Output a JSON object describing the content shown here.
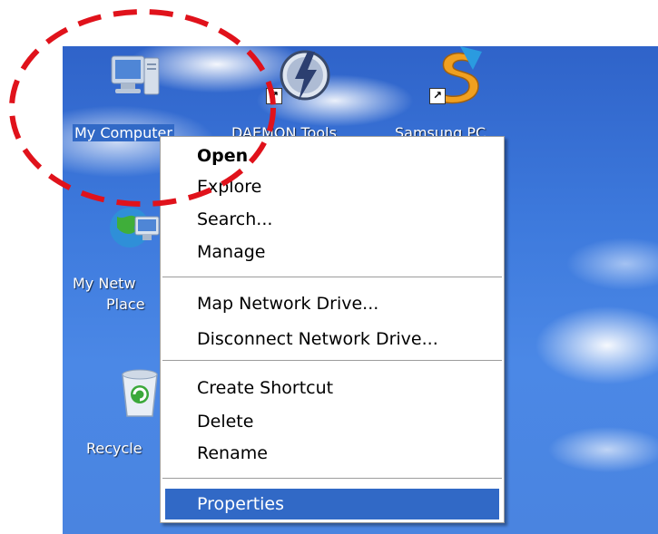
{
  "desktop": {
    "icons": [
      {
        "label": "My Computer",
        "visible_label": "My Computer",
        "selected": true
      },
      {
        "label": "DAEMON Tools"
      },
      {
        "label": "Samsung PC"
      },
      {
        "label_line1": "My Netw",
        "label_line2": "Place"
      },
      {
        "label": "Recycle"
      }
    ]
  },
  "context_menu": {
    "items": [
      {
        "label": "Open",
        "default": true
      },
      {
        "label": "Explore"
      },
      {
        "label": "Search..."
      },
      {
        "label": "Manage"
      },
      {
        "label": "Map Network Drive..."
      },
      {
        "label": "Disconnect Network Drive..."
      },
      {
        "label": "Create Shortcut"
      },
      {
        "label": "Delete"
      },
      {
        "label": "Rename"
      },
      {
        "label": "Properties",
        "highlighted": true
      }
    ]
  },
  "annotation": {
    "shape": "dashed-ellipse",
    "color": "#e0121b"
  },
  "colors": {
    "selection": "#3169c6",
    "desktop_blue": "#3d79dc"
  }
}
